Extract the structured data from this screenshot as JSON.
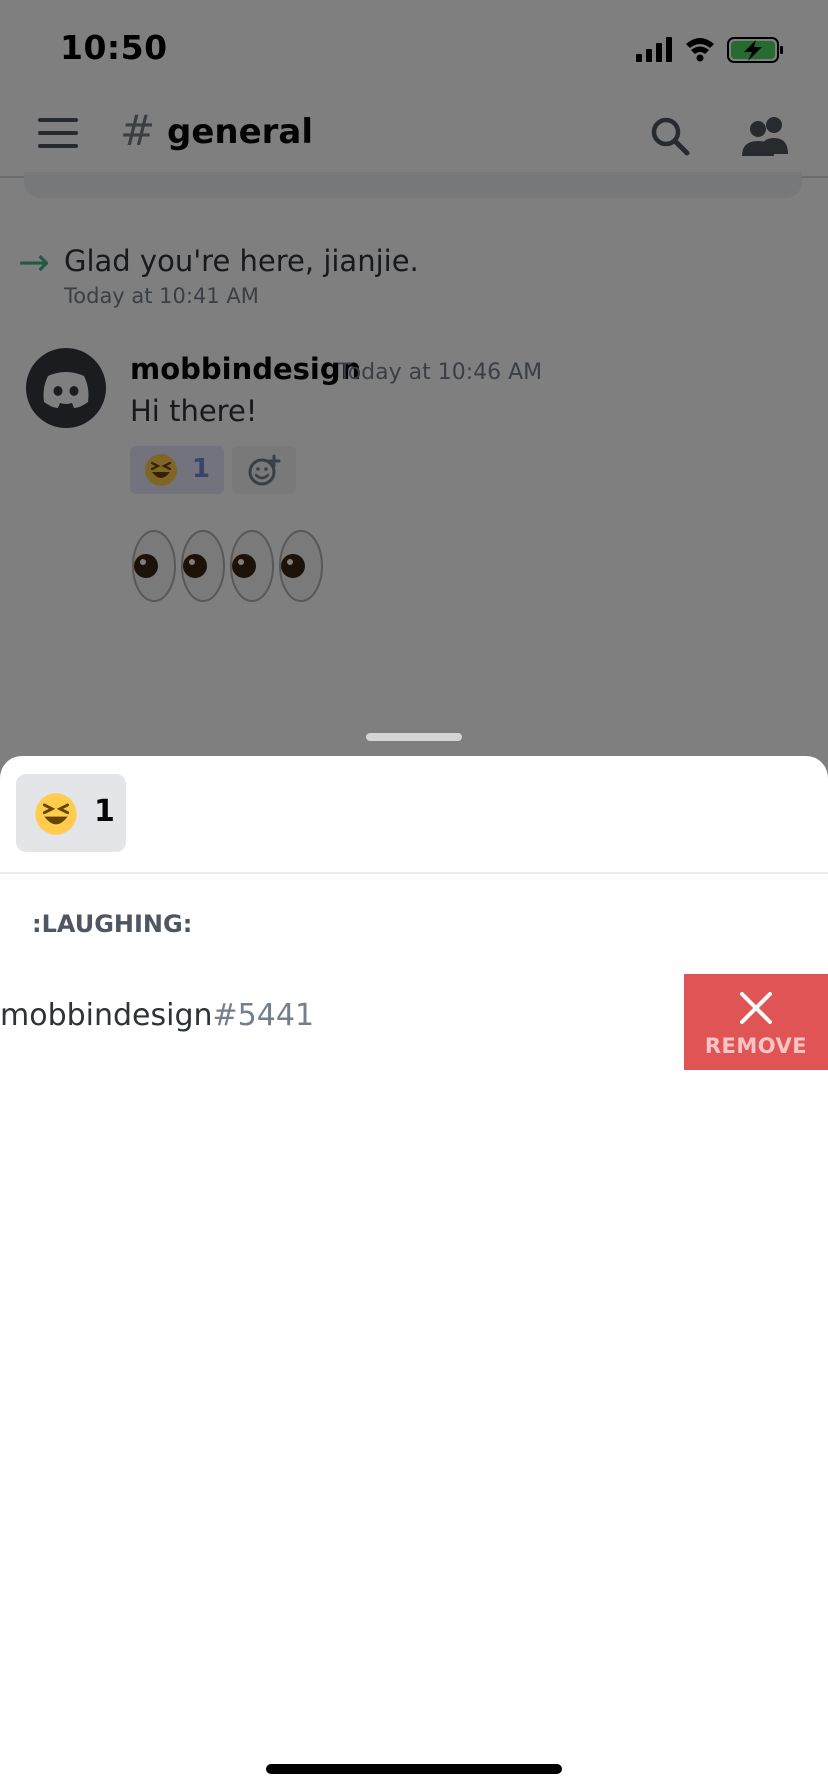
{
  "status_bar": {
    "time": "10:50"
  },
  "header": {
    "channel_hash": "#",
    "channel_name": "general"
  },
  "messages": {
    "join": {
      "text": "Glad you're here, jianjie.",
      "timestamp": "Today at 10:41 AM"
    },
    "post": {
      "author": "mobbindesign",
      "timestamp": "Today at 10:46 AM",
      "text": "Hi there!",
      "reaction": {
        "emoji": "laughing",
        "count": "1"
      }
    }
  },
  "sheet": {
    "tab": {
      "emoji": "laughing",
      "count": "1"
    },
    "section_title": ":LAUGHING:",
    "user": {
      "name": "mobbindesign",
      "discriminator": "#5441"
    },
    "remove_label": "REMOVE"
  },
  "colors": {
    "blurple": "#7289da",
    "remove_red": "#e05455",
    "join_green": "#43b581"
  }
}
